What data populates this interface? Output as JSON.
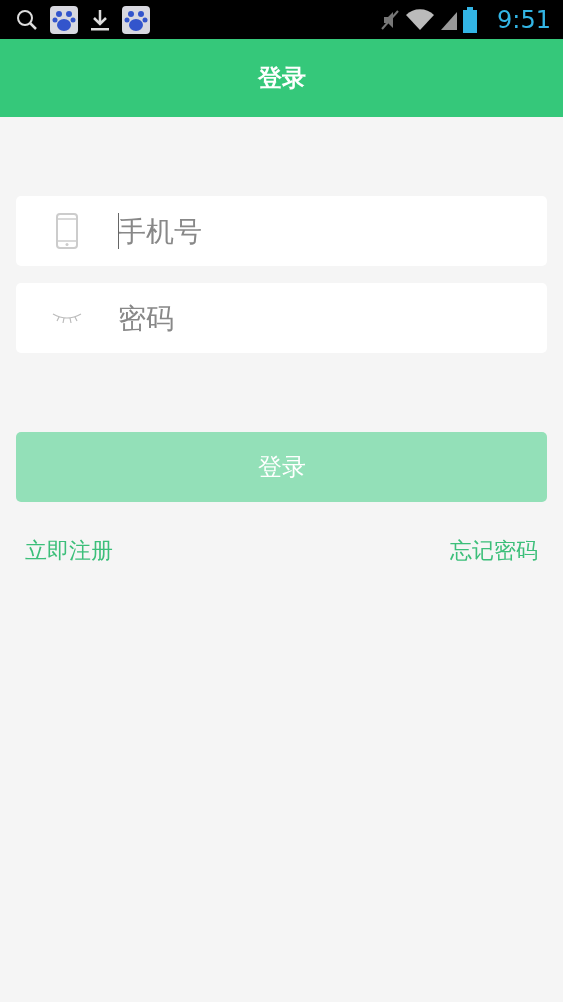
{
  "status_bar": {
    "time": "9:51"
  },
  "header": {
    "title": "登录"
  },
  "fields": [
    {
      "kind": "phone",
      "placeholder": "手机号",
      "focused": true
    },
    {
      "kind": "password",
      "placeholder": "密码",
      "focused": false
    }
  ],
  "login_button": {
    "label": "登录",
    "disabled": true
  },
  "links": [
    {
      "label": "立即注册"
    },
    {
      "label": "忘记密码"
    }
  ]
}
